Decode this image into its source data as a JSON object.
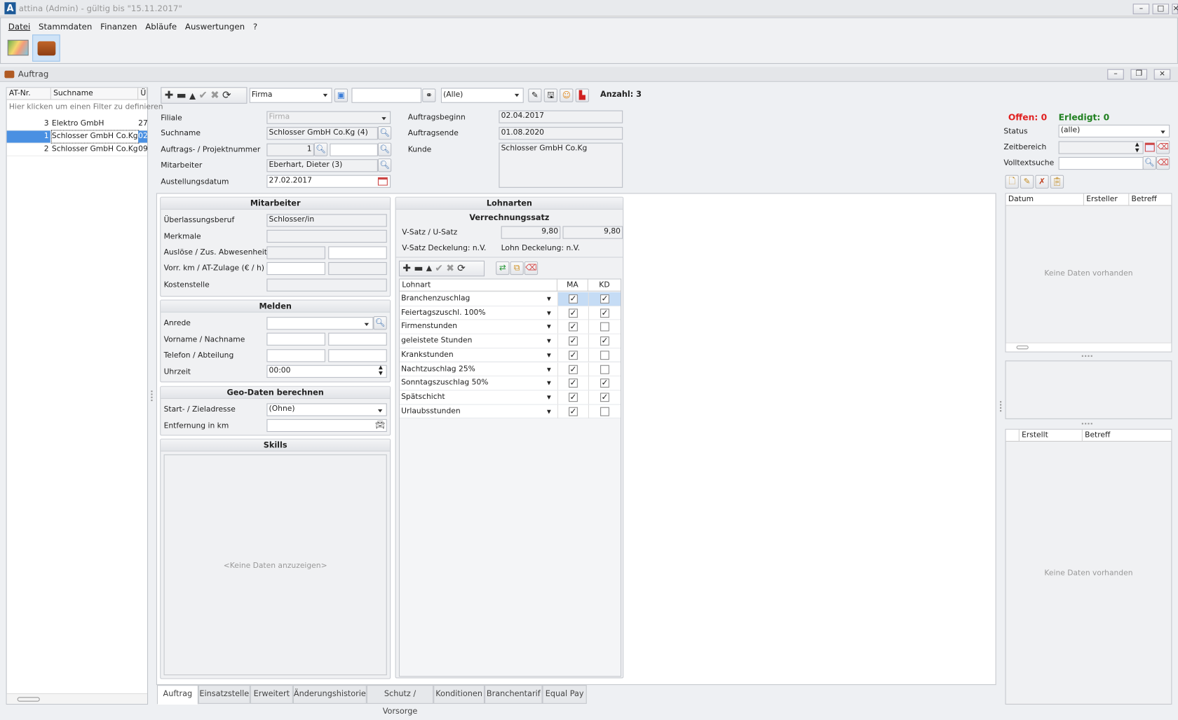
{
  "app": {
    "title": "attina (Admin) - gültig bis \"15.11.2017\"",
    "logo_letter": "A",
    "menu": [
      "Datei",
      "Stammdaten",
      "Finanzen",
      "Abläufe",
      "Auswertungen",
      "?"
    ],
    "window_buttons": [
      "minimize",
      "maximize",
      "close"
    ]
  },
  "child": {
    "title": "Auftrag"
  },
  "list": {
    "columns": [
      "AT-Nr.",
      "Suchname",
      "Üb"
    ],
    "filter_hint": "Hier klicken um einen Filter zu definieren",
    "rows": [
      {
        "nr": "3",
        "name": "Elektro GmbH",
        "ub": "27",
        "selected": false
      },
      {
        "nr": "1",
        "name": "Schlosser GmbH Co.Kg",
        "ub": "02",
        "selected": true
      },
      {
        "nr": "2",
        "name": "Schlosser GmbH Co.Kg",
        "ub": "09",
        "selected": false
      }
    ]
  },
  "toolbar": {
    "filter_field": "Firma",
    "search_value": "",
    "status_filter": "(Alle)",
    "count": "Anzahl: 3"
  },
  "form": {
    "filiale": {
      "label": "Filiale",
      "value": "Firma"
    },
    "suchname": {
      "label": "Suchname",
      "value": "Schlosser GmbH Co.Kg (4)"
    },
    "auftragsnr": {
      "label": "Auftrags- / Projektnummer",
      "value": "1",
      "value2": ""
    },
    "mitarbeiter": {
      "label": "Mitarbeiter",
      "value": "Eberhart, Dieter (3)"
    },
    "ausstellung": {
      "label": "Austellungsdatum",
      "value": "27.02.2017"
    },
    "beginn": {
      "label": "Auftragsbeginn",
      "value": "02.04.2017"
    },
    "ende": {
      "label": "Auftragsende",
      "value": "01.08.2020"
    },
    "kunde": {
      "label": "Kunde",
      "value": "Schlosser GmbH Co.Kg"
    }
  },
  "mitarbeiter_group": {
    "title": "Mitarbeiter",
    "beruf_label": "Überlassungsberuf",
    "beruf": "Schlosser/in",
    "merkmale_label": "Merkmale",
    "ausloese_label": "Auslöse / Zus. Abwesenheit",
    "vorr_label": "Vorr. km / AT-Zulage (€ / h)",
    "kosten_label": "Kostenstelle"
  },
  "melden": {
    "title": "Melden",
    "anrede_label": "Anrede",
    "name_label": "Vorname / Nachname",
    "telefon_label": "Telefon / Abteilung",
    "uhrzeit_label": "Uhrzeit",
    "uhrzeit": "00:00"
  },
  "geo": {
    "title": "Geo-Daten berechnen",
    "start_label": "Start- / Zieladresse",
    "start": "(Ohne)",
    "entf_label": "Entfernung in km"
  },
  "skills": {
    "title": "Skills",
    "empty": "<Keine Daten anzuzeigen>"
  },
  "lohnarten": {
    "title": "Lohnarten",
    "sub": "Verrechnungssatz",
    "satz_label": "V-Satz / U-Satz",
    "v_satz": "9,80",
    "u_satz": "9,80",
    "v_deck": "V-Satz Deckelung: n.V.",
    "lohn_deck": "Lohn Deckelung: n.V.",
    "columns": [
      "Lohnart",
      "MA",
      "KD"
    ],
    "rows": [
      {
        "name": "Branchenzuschlag",
        "ma": true,
        "kd": true
      },
      {
        "name": "Feiertagszuschl. 100%",
        "ma": true,
        "kd": true
      },
      {
        "name": "Firmenstunden",
        "ma": true,
        "kd": false
      },
      {
        "name": "geleistete Stunden",
        "ma": true,
        "kd": true
      },
      {
        "name": "Krankstunden",
        "ma": true,
        "kd": false
      },
      {
        "name": "Nachtzuschlag 25%",
        "ma": true,
        "kd": false
      },
      {
        "name": "Sonntagszuschlag 50%",
        "ma": true,
        "kd": true
      },
      {
        "name": "Spätschicht",
        "ma": true,
        "kd": true
      },
      {
        "name": "Urlaubsstunden",
        "ma": true,
        "kd": false
      }
    ]
  },
  "tabs": [
    "Auftrag",
    "Einsatzstelle",
    "Erweitert",
    "Änderungshistorie",
    "Schutz / Vorsorge",
    "Konditionen",
    "Branchentarif",
    "Equal Pay"
  ],
  "right": {
    "offen": "Offen: 0",
    "erledigt": "Erledigt: 0",
    "status_label": "Status",
    "status": "(alle)",
    "zeit_label": "Zeitbereich",
    "voll_label": "Volltextsuche",
    "grid1_cols": [
      "Datum",
      "Ersteller",
      "Betreff"
    ],
    "grid1_empty": "Keine Daten vorhanden",
    "grid2_cols": [
      "Erstellt",
      "Betreff"
    ],
    "grid2_empty": "Keine Daten vorhanden"
  },
  "colors": {
    "offen": "#e02020",
    "erledigt": "#208020",
    "selection": "#4a90e2",
    "row_highlight": "#c5dcf5"
  }
}
